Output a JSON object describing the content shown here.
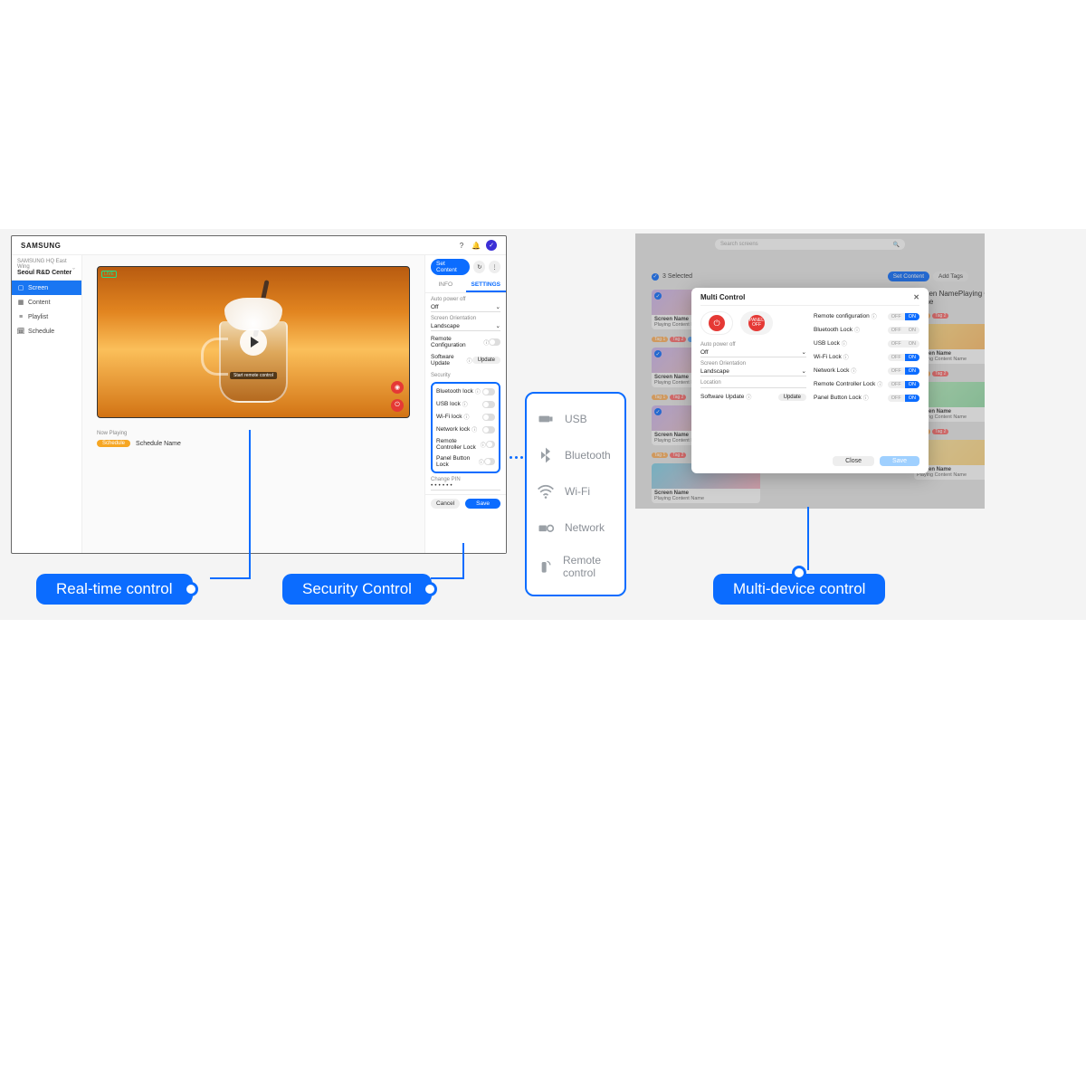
{
  "brand": "SAMSUNG",
  "location": {
    "sub": "SAMSUNG HQ East Wing",
    "main": "Seoul R&D Center"
  },
  "sidebar": {
    "items": [
      {
        "label": "Screen",
        "icon": "▢",
        "active": true
      },
      {
        "label": "Content",
        "icon": "▦",
        "active": false
      },
      {
        "label": "Playlist",
        "icon": "≡",
        "active": false
      },
      {
        "label": "Schedule",
        "icon": "🗓",
        "active": false
      }
    ]
  },
  "preview": {
    "live_tag": "LIVE",
    "caption": "Start remote control"
  },
  "now_playing": {
    "heading": "Now Playing",
    "badge": "Schedule",
    "name": "Schedule Name"
  },
  "panel": {
    "set_content": "Set Content",
    "tabs": {
      "info": "INFO",
      "settings": "SETTINGS"
    },
    "auto_power": {
      "label": "Auto power off",
      "value": "Off"
    },
    "orientation": {
      "label": "Screen Orientation",
      "value": "Landscape"
    },
    "remote_config": "Remote Configuration",
    "sw_update": {
      "label": "Software Update",
      "button": "Update"
    },
    "security_heading": "Security",
    "security": [
      "Bluetooth lock",
      "USB lock",
      "Wi-Fi lock",
      "Network lock",
      "Remote Controller Lock",
      "Panel Button Lock"
    ],
    "change_pin": {
      "label": "Change PIN",
      "value": "••••••"
    },
    "footer": {
      "cancel": "Cancel",
      "save": "Save"
    }
  },
  "callout": {
    "items": [
      {
        "label": "USB",
        "icon": "usb"
      },
      {
        "label": "Bluetooth",
        "icon": "bluetooth"
      },
      {
        "label": "Wi-Fi",
        "icon": "wifi"
      },
      {
        "label": "Network",
        "icon": "network"
      },
      {
        "label": "Remote control",
        "icon": "remote"
      }
    ]
  },
  "right": {
    "search_placeholder": "Search screens",
    "selected_text": "3 Selected",
    "actions": {
      "set_content": "Set Content",
      "add_tags": "Add Tags"
    },
    "card": {
      "title": "Screen Name",
      "sub": "Playing Content Name"
    },
    "tags": [
      "Tag 1",
      "Tag 2",
      "Tag 3"
    ]
  },
  "modal": {
    "title": "Multi Control",
    "auto_power": {
      "label": "Auto power off",
      "value": "Off"
    },
    "orientation": {
      "label": "Screen Orientation",
      "value": "Landscape"
    },
    "location": "Location",
    "sw_update": {
      "label": "Software Update",
      "button": "Update"
    },
    "locks": [
      {
        "label": "Remote configuration",
        "on": true
      },
      {
        "label": "Bluetooth Lock",
        "on": false
      },
      {
        "label": "USB Lock",
        "on": false
      },
      {
        "label": "Wi-Fi Lock",
        "on": true
      },
      {
        "label": "Network Lock",
        "on": true
      },
      {
        "label": "Remote Controller Lock",
        "on": true
      },
      {
        "label": "Panel Button Lock",
        "on": true
      }
    ],
    "footer": {
      "close": "Close",
      "save": "Save"
    }
  },
  "pills": {
    "realtime": "Real-time control",
    "security": "Security Control",
    "multi": "Multi-device control"
  }
}
